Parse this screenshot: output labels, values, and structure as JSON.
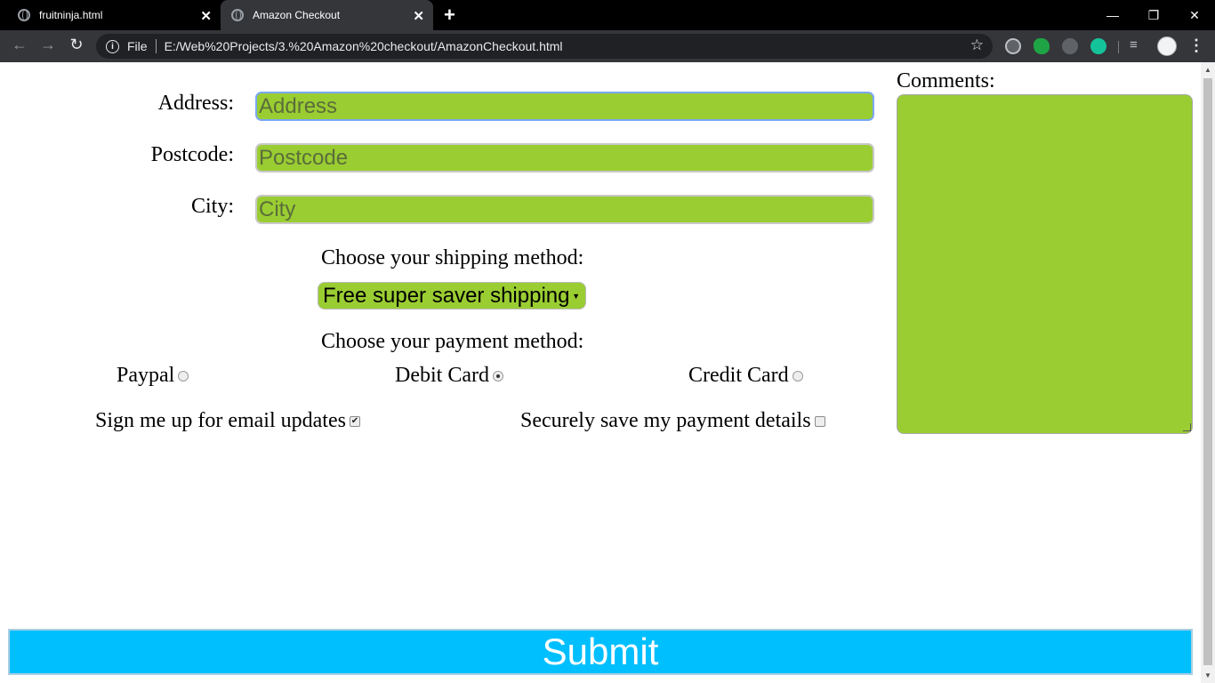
{
  "browser": {
    "tabs": [
      {
        "title": "fruitninja.html"
      },
      {
        "title": "Amazon Checkout"
      }
    ],
    "new_tab": "+",
    "window_controls": {
      "minimize": "—",
      "restore": "❐",
      "close": "✕"
    },
    "nav": {
      "back": "←",
      "forward": "→",
      "reload": "↻"
    },
    "omnibox": {
      "scheme_label": "File",
      "url": "E:/Web%20Projects/3.%20Amazon%20checkout/AmazonCheckout.html"
    },
    "extensions": [
      "keyhole-icon",
      "evernote-icon",
      "pinterest-icon",
      "grammarly-icon",
      "media-control-icon"
    ],
    "menu": "⋮"
  },
  "form": {
    "address": {
      "label": "Address:",
      "placeholder": "Address"
    },
    "postcode": {
      "label": "Postcode:",
      "placeholder": "Postcode"
    },
    "city": {
      "label": "City:",
      "placeholder": "City"
    },
    "shipping": {
      "label": "Choose your shipping method:",
      "selected": "Free super saver shipping"
    },
    "payment": {
      "label": "Choose your payment method:",
      "options": [
        {
          "label": "Paypal",
          "checked": false
        },
        {
          "label": "Debit Card",
          "checked": true
        },
        {
          "label": "Credit Card",
          "checked": false
        }
      ]
    },
    "email_updates": {
      "label": "Sign me up for email updates",
      "checked": true
    },
    "save_payment": {
      "label": "Securely save my payment details",
      "checked": false
    },
    "comments": {
      "label": "Comments:",
      "value": ""
    },
    "submit": {
      "label": "Submit"
    }
  },
  "colors": {
    "field_bg": "#9acd32",
    "submit_bg": "#00bfff",
    "chrome_bg": "#000000",
    "toolbar_bg": "#35363a"
  }
}
